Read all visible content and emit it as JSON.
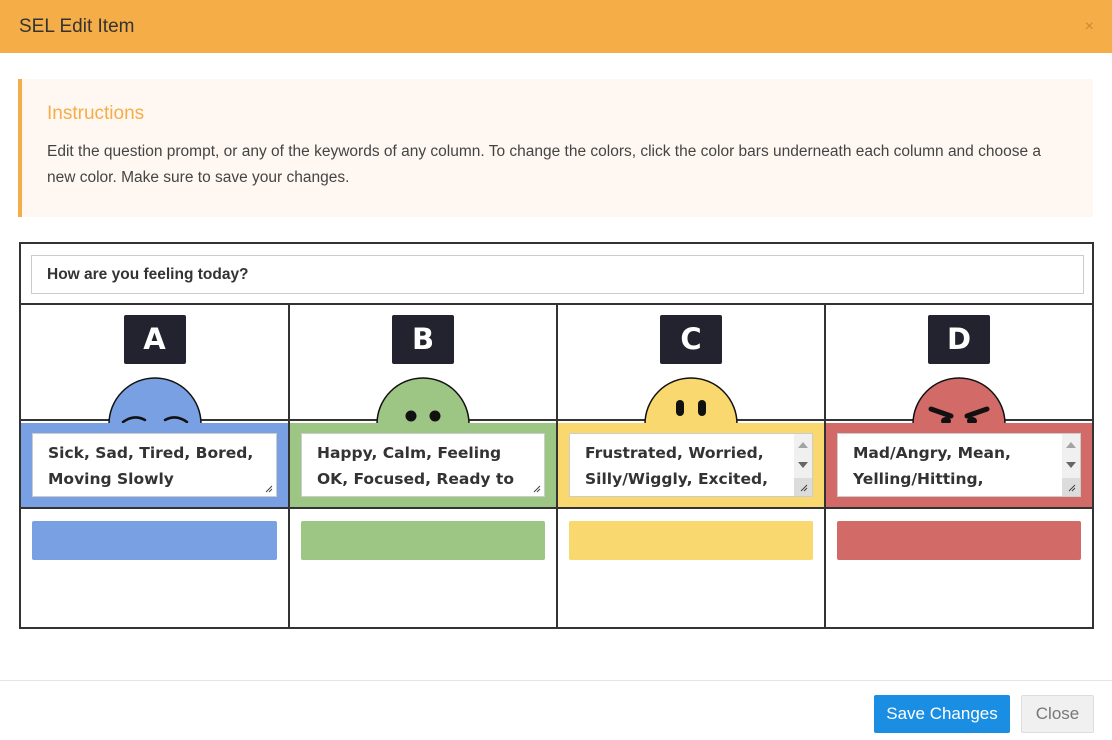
{
  "modal": {
    "title": "SEL Edit Item",
    "close_symbol": "×"
  },
  "instructions": {
    "title": "Instructions",
    "text": "Edit the question prompt, or any of the keywords of any column. To change the colors, click the color bars underneath each column and choose a new color. Make sure to save your changes."
  },
  "prompt": {
    "value": "How are you feeling today?"
  },
  "columns": [
    {
      "letter": "A",
      "face": "sad-face-icon",
      "keywords": "Sick, Sad, Tired, Bored, Moving Slowly",
      "color": "#7aa0e4"
    },
    {
      "letter": "B",
      "face": "happy-face-icon",
      "keywords": "Happy, Calm, Feeling OK, Focused, Ready to Learn",
      "color": "#9dc583"
    },
    {
      "letter": "C",
      "face": "neutral-face-icon",
      "keywords": "Frustrated, Worried, Silly/Wiggly, Excited,",
      "color": "#f9d870"
    },
    {
      "letter": "D",
      "face": "angry-face-icon",
      "keywords": "Mad/Angry, Mean, Yelling/Hitting,",
      "color": "#d26b68"
    }
  ],
  "footer": {
    "save_label": "Save Changes",
    "close_label": "Close"
  }
}
